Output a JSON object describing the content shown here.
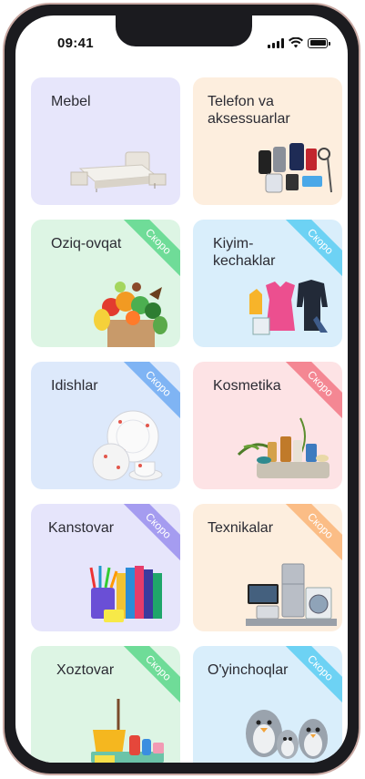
{
  "status_bar": {
    "time": "09:41"
  },
  "soon_label": "Скоро",
  "categories": [
    {
      "name": "Mebel",
      "bg": "#e7e6fb",
      "soon": false,
      "ribbon_color": ""
    },
    {
      "name": "Telefon va aksessuarlar",
      "bg": "#fdeede",
      "soon": false,
      "ribbon_color": ""
    },
    {
      "name": "Oziq-ovqat",
      "bg": "#ddf5e4",
      "soon": true,
      "ribbon_color": "#6fdc98"
    },
    {
      "name": "Kiyim-kechaklar",
      "bg": "#d9eefb",
      "soon": true,
      "ribbon_color": "#6dd2f4"
    },
    {
      "name": "Idishlar",
      "bg": "#dde9fb",
      "soon": true,
      "ribbon_color": "#7fb4f4"
    },
    {
      "name": "Kosmetika",
      "bg": "#fde3e5",
      "soon": true,
      "ribbon_color": "#f48793"
    },
    {
      "name": "Kanstovar",
      "bg": "#e6e5fb",
      "soon": true,
      "ribbon_color": "#a59cf0"
    },
    {
      "name": "Texnikalar",
      "bg": "#fdeede",
      "soon": true,
      "ribbon_color": "#fbbd86"
    },
    {
      "name": "Xoztovar",
      "bg": "#ddf5e4",
      "soon": true,
      "ribbon_color": "#6fdc98"
    },
    {
      "name": "O'yinchoqlar",
      "bg": "#d9eefb",
      "soon": true,
      "ribbon_color": "#6dd2f4"
    }
  ],
  "icons": [
    "bed-icon",
    "phones-icon",
    "groceries-icon",
    "clothes-icon",
    "dishes-icon",
    "cosmetics-icon",
    "stationery-icon",
    "appliances-icon",
    "cleaning-icon",
    "toys-icon"
  ]
}
